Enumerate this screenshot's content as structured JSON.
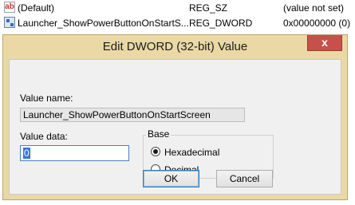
{
  "registry_list": [
    {
      "icon": "string-value-icon",
      "icon_glyph": "ab",
      "name": "(Default)",
      "type": "REG_SZ",
      "data": "(value not set)"
    },
    {
      "icon": "dword-value-icon",
      "name": "Launcher_ShowPowerButtonOnStartS...",
      "type": "REG_DWORD",
      "data": "0x00000000 (0)"
    }
  ],
  "dialog": {
    "title": "Edit DWORD (32-bit) Value",
    "close_glyph": "x",
    "value_name_label": "Value name:",
    "value_name": "Launcher_ShowPowerButtonOnStartScreen",
    "value_data_label": "Value data:",
    "value_data": "0",
    "base_label": "Base",
    "base_options": [
      {
        "label": "Hexadecimal",
        "selected": true
      },
      {
        "label": "Decimal",
        "selected": false
      }
    ],
    "ok_label": "OK",
    "cancel_label": "Cancel"
  },
  "colors": {
    "frame": "#ead9a4",
    "close_button": "#c7504a",
    "selection": "#3875d7"
  }
}
